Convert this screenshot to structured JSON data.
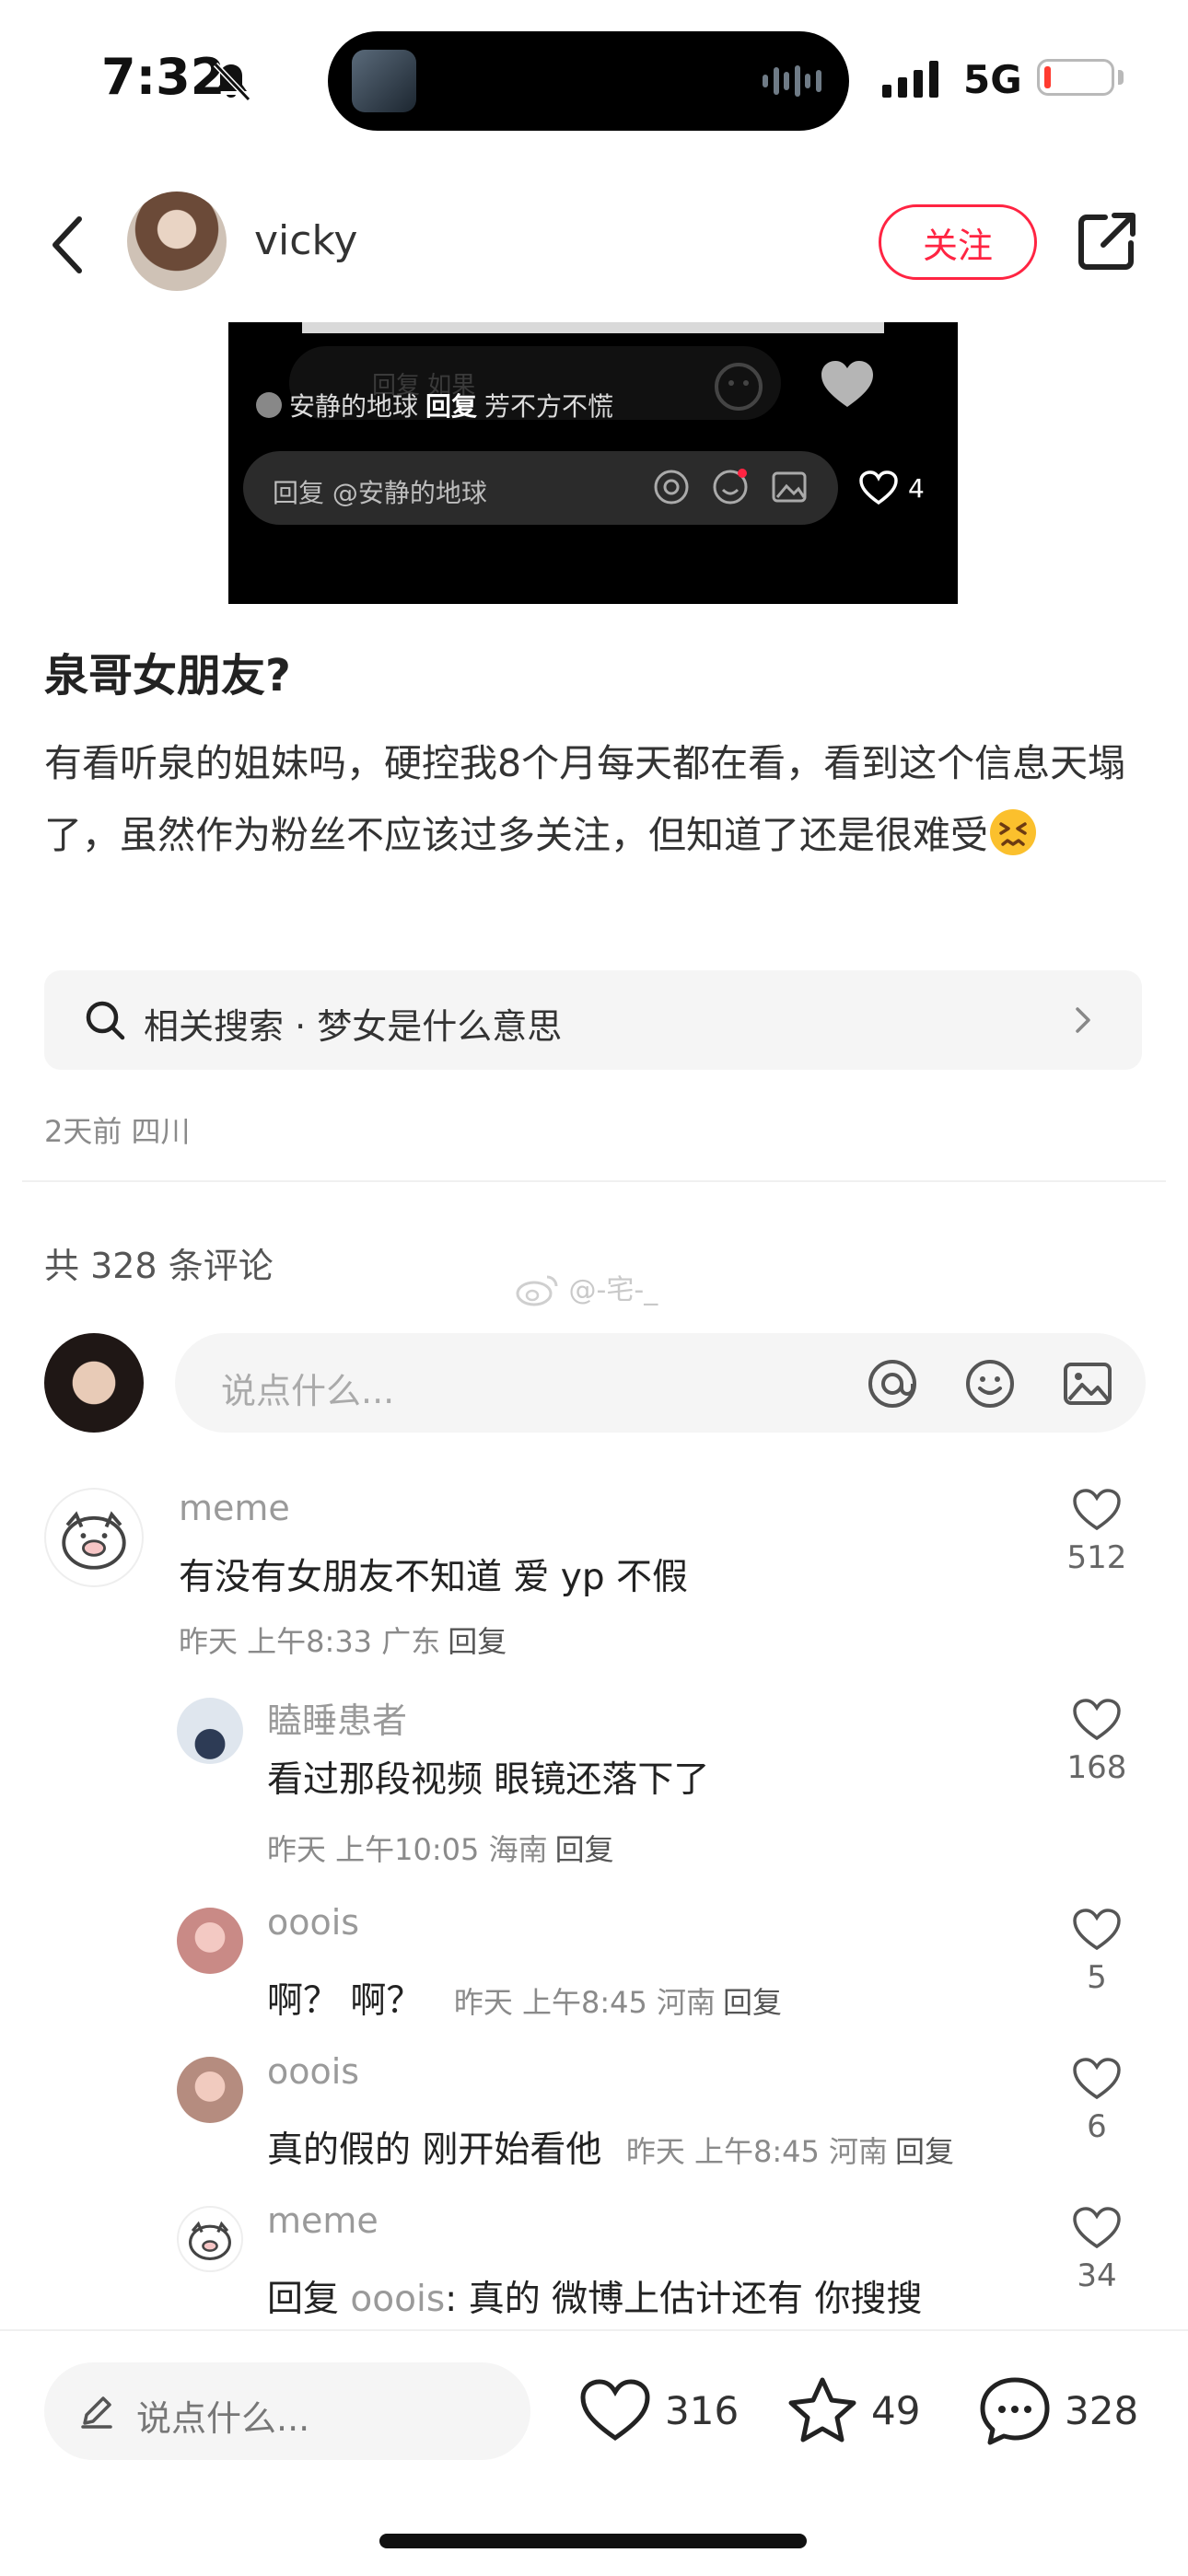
{
  "status_bar": {
    "time": "7:32",
    "network": "5G",
    "battery_level": 0.1
  },
  "colors": {
    "accent": "#ff2442",
    "text_primary": "#222222",
    "text_secondary": "#8a8a8a",
    "chip_bg": "#f5f5f5"
  },
  "header": {
    "author_name": "vicky",
    "follow_label": "关注"
  },
  "media": {
    "ghost_text": "回复 如果",
    "reply_user": "安静的地球",
    "reply_word": "回复",
    "reply_target": "芳不方不慌",
    "input_placeholder": "回复 @安静的地球",
    "like_count": "4"
  },
  "post": {
    "title": "泉哥女朋友?",
    "body": "有看听泉的姐妹吗，硬控我8个月每天都在看，看到这个信息天塌了，虽然作为粉丝不应该过多关注，但知道了还是很难受",
    "search_chip": "相关搜索 · 梦女是什么意思",
    "meta": "2天前 四川"
  },
  "comments_section": {
    "count_label": "共 328 条评论",
    "watermark": "@-宅-_",
    "input_placeholder": "说点什么...",
    "comments": [
      {
        "user": "meme",
        "text": "有没有女朋友不知道 爱 yp 不假",
        "meta": "昨天 上午8:33 广东",
        "reply": "回复",
        "likes": "512"
      },
      {
        "user": "瞌睡患者",
        "text": "看过那段视频 眼镜还落下了",
        "meta": "昨天 上午10:05 海南",
        "reply": "回复",
        "likes": "168"
      },
      {
        "user": "ooois",
        "text": "啊？ 啊？",
        "meta": "昨天 上午8:45 河南",
        "reply": "回复",
        "likes": "5"
      },
      {
        "user": "ooois",
        "text": "真的假的 刚开始看他",
        "meta": "昨天 上午8:45 河南",
        "reply": "回复",
        "likes": "6"
      },
      {
        "user": "meme",
        "reply_prefix": "回复",
        "reply_to": "ooois",
        "text": ": 真的 微博上估计还有 你搜搜",
        "likes": "34"
      }
    ]
  },
  "bottom_bar": {
    "input_placeholder": "说点什么...",
    "likes": "316",
    "favorites": "49",
    "comments": "328"
  }
}
